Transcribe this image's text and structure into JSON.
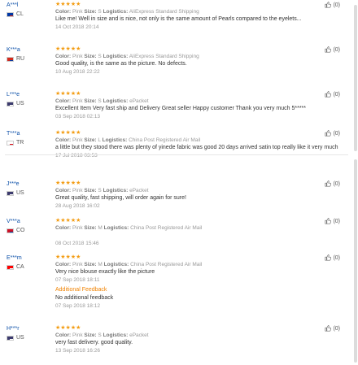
{
  "reviews": [
    {
      "user": "A***l",
      "country": "CL",
      "flag_colors": [
        "#ffffff",
        "#d52b1e",
        "#0039a6"
      ],
      "stars": "★★★★★",
      "color_label": "Color:",
      "color": "Pink",
      "size_label": "Size:",
      "size": "S",
      "logistics_label": "Logistics:",
      "logistics": "AliExpress Standard Shipping",
      "text": "Like me! Well in size and is nice, not only is the same amount of Pearls compared to the eyelets...",
      "date": "14 Oct 2018 20:14",
      "helpful": "(0)"
    },
    {
      "user": "K***a",
      "country": "RU",
      "flag_colors": [
        "#ffffff",
        "#0039a6",
        "#d52b1e"
      ],
      "stars": "★★★★★",
      "color_label": "Color:",
      "color": "Pink",
      "size_label": "Size:",
      "size": "S",
      "logistics_label": "Logistics:",
      "logistics": "AliExpress Standard Shipping",
      "text": "Good quality, is the same as the picture. No defects.",
      "date": "10 Aug 2018 22:22",
      "helpful": "(0)"
    },
    {
      "user": "L***e",
      "country": "US",
      "flag_colors": [
        "#b22234",
        "#ffffff",
        "#3c3b6e"
      ],
      "stars": "★★★★★",
      "color_label": "Color:",
      "color": "Pink",
      "size_label": "Size:",
      "size": "S",
      "logistics_label": "Logistics:",
      "logistics": "ePacket",
      "text": "Excellent Item Very fast ship and Delivery Great seller Happy customer Thank you very much 5*****",
      "date": "03 Sep 2018 02:13",
      "helpful": "(0)"
    },
    {
      "user": "T***a",
      "country": "TR",
      "flag_colors": [
        "#e30a17",
        "#e30a17",
        "#ffffff"
      ],
      "stars": "★★★★★",
      "color_label": "Color:",
      "color": "Pink",
      "size_label": "Size:",
      "size": "L",
      "logistics_label": "Logistics:",
      "logistics": "China Post Registered Air Mail",
      "text": "a little but they stood there was plenty of yinede fabric was good 20 days arrived satin top really like it very much",
      "date": "17 Jul 2018 03:53",
      "helpful": "(0)"
    },
    {
      "user": "J***e",
      "country": "US",
      "flag_colors": [
        "#b22234",
        "#ffffff",
        "#3c3b6e"
      ],
      "stars": "★★★★★",
      "color_label": "Color:",
      "color": "Pink",
      "size_label": "Size:",
      "size": "S",
      "logistics_label": "Logistics:",
      "logistics": "ePacket",
      "text": "Great quality, fast shipping, will order again for sure!",
      "date": "28 Aug 2018 16:02",
      "helpful": "(0)"
    },
    {
      "user": "V***a",
      "country": "CO",
      "flag_colors": [
        "#fcd116",
        "#003893",
        "#ce1126"
      ],
      "stars": "★★★★★",
      "color_label": "Color:",
      "color": "Pink",
      "size_label": "Size:",
      "size": "M",
      "logistics_label": "Logistics:",
      "logistics": "China Post Registered Air Mail",
      "text": "",
      "date": "08 Oct 2018 15:46",
      "helpful": "(0)"
    },
    {
      "user": "E***m",
      "country": "CA",
      "flag_colors": [
        "#ff0000",
        "#ffffff",
        "#ff0000"
      ],
      "stars": "★★★★★",
      "color_label": "Color:",
      "color": "Pink",
      "size_label": "Size:",
      "size": "M",
      "logistics_label": "Logistics:",
      "logistics": "China Post Registered Air Mail",
      "text": "Very nice blouse exactly like the picture",
      "date": "07 Sep 2018 18:11",
      "additional_title": "Additional Feedback",
      "additional_text": "No additional feedback",
      "additional_date": "07 Sep 2018 18:12",
      "helpful": "(0)"
    },
    {
      "user": "H***r",
      "country": "US",
      "flag_colors": [
        "#b22234",
        "#ffffff",
        "#3c3b6e"
      ],
      "stars": "★★★★★",
      "color_label": "Color:",
      "color": "Pink",
      "size_label": "Size:",
      "size": "S",
      "logistics_label": "Logistics:",
      "logistics": "ePacket",
      "text": "very fast delivery. good quality.",
      "date": "13 Sep 2018 16:26",
      "helpful": "(0)"
    }
  ]
}
